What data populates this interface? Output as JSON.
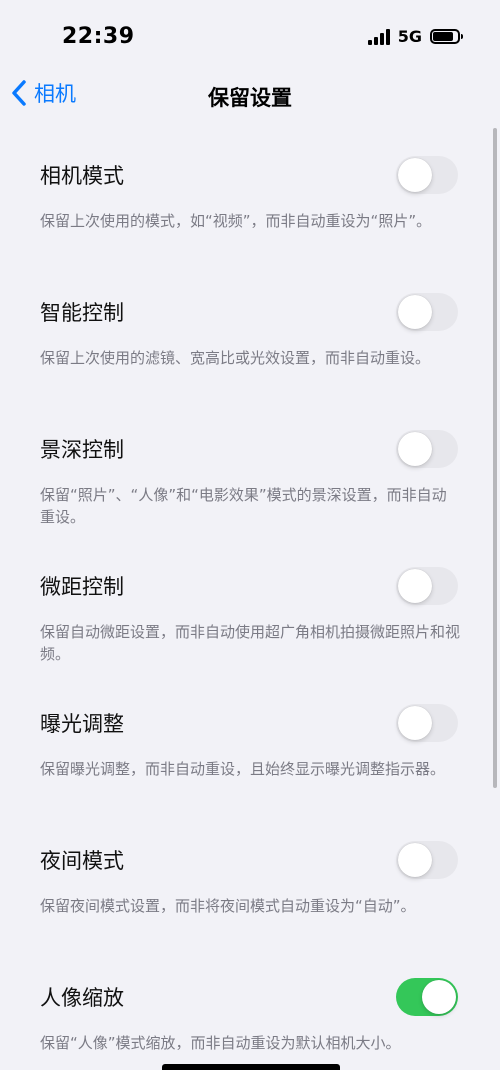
{
  "status_bar": {
    "time": "22:39",
    "network": "5G",
    "signal_bars": 4,
    "battery_level": 0.85
  },
  "nav": {
    "back_label": "相机",
    "title": "保留设置",
    "accent_color": "#0a7aff"
  },
  "settings": [
    {
      "label": "相机模式",
      "description": "保留上次使用的模式，如“视频”，而非自动重设为“照片”。",
      "enabled": false
    },
    {
      "label": "智能控制",
      "description": "保留上次使用的滤镜、宽高比或光效设置，而非自动重设。",
      "enabled": false
    },
    {
      "label": "景深控制",
      "description": "保留“照片”、“人像”和“电影效果”模式的景深设置，而非自动重设。",
      "enabled": false
    },
    {
      "label": "微距控制",
      "description": "保留自动微距设置，而非自动使用超广角相机拍摄微距照片和视频。",
      "enabled": false
    },
    {
      "label": "曝光调整",
      "description": "保留曝光调整，而非自动重设，且始终显示曝光调整指示器。",
      "enabled": false
    },
    {
      "label": "夜间模式",
      "description": "保留夜间模式设置，而非将夜间模式自动重设为“自动”。",
      "enabled": false
    },
    {
      "label": "人像缩放",
      "description": "保留“人像”模式缩放，而非自动重设为默认相机大小。",
      "enabled": true
    }
  ],
  "colors": {
    "toggle_on": "#34c759",
    "toggle_off": "#e7e7ec",
    "background": "#f2f2f7"
  }
}
